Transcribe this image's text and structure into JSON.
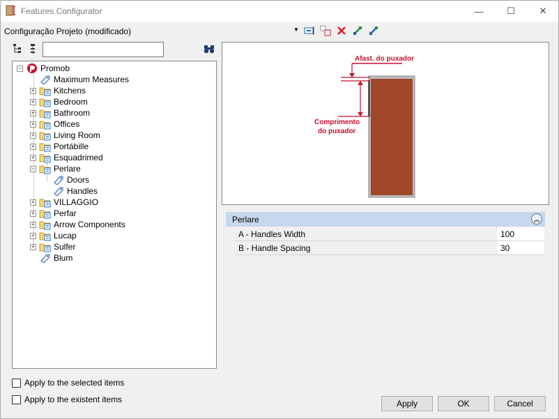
{
  "window": {
    "title": "Features Configurator",
    "minimize_glyph": "—",
    "maximize_glyph": "☐",
    "close_glyph": "✕"
  },
  "config": {
    "label": "Configuração Projeto (modificado)",
    "dropdown_glyph": "▼"
  },
  "search": {
    "value": "",
    "placeholder": ""
  },
  "tree": {
    "root": "Promob",
    "items": [
      {
        "label": "Maximum Measures"
      },
      {
        "label": "Kitchens"
      },
      {
        "label": "Bedroom"
      },
      {
        "label": "Bathroom"
      },
      {
        "label": "Offices"
      },
      {
        "label": "Living Room"
      },
      {
        "label": "Portábille"
      },
      {
        "label": "Esquadrimed"
      },
      {
        "label": "Perlare"
      },
      {
        "label": "Doors"
      },
      {
        "label": "Handles"
      },
      {
        "label": "VILLAGGIO"
      },
      {
        "label": "Perfar"
      },
      {
        "label": "Arrow Components"
      },
      {
        "label": "Lucap"
      },
      {
        "label": "Sulfer"
      },
      {
        "label": "Blum"
      }
    ]
  },
  "options": {
    "apply_selected": "Apply to the selected items",
    "apply_existent": "Apply to the existent items"
  },
  "preview": {
    "label_top": "Afast. do puxador",
    "label_side_1": "Comprimento",
    "label_side_2": "do puxador",
    "door_color": "#a0472b",
    "annotation_color": "#c8102e"
  },
  "properties": {
    "group": "Perlare",
    "rows": [
      {
        "name": "A -  Handles Width",
        "value": "100"
      },
      {
        "name": "B -  Handle Spacing",
        "value": "30"
      }
    ]
  },
  "buttons": {
    "apply": "Apply",
    "ok": "OK",
    "cancel": "Cancel"
  }
}
